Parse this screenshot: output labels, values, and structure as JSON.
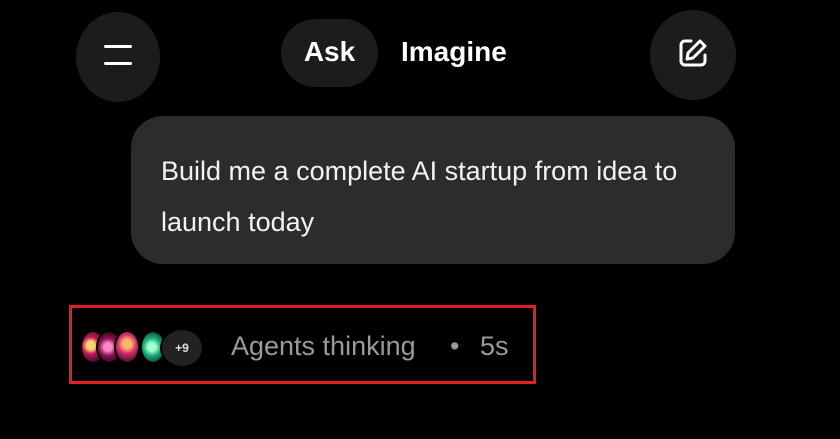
{
  "header": {
    "menu_icon": "hamburger-menu-icon",
    "tabs": [
      {
        "label": "Ask",
        "selected": true
      },
      {
        "label": "Imagine",
        "selected": false
      }
    ],
    "new_chat_icon": "edit-square-icon"
  },
  "conversation": {
    "user_message": "Build me a complete AI startup from idea to launch today"
  },
  "status": {
    "extra_agents": "+9",
    "label": "Agents thinking",
    "separator": "•",
    "elapsed": "5s",
    "highlight_color": "#e01e26"
  }
}
